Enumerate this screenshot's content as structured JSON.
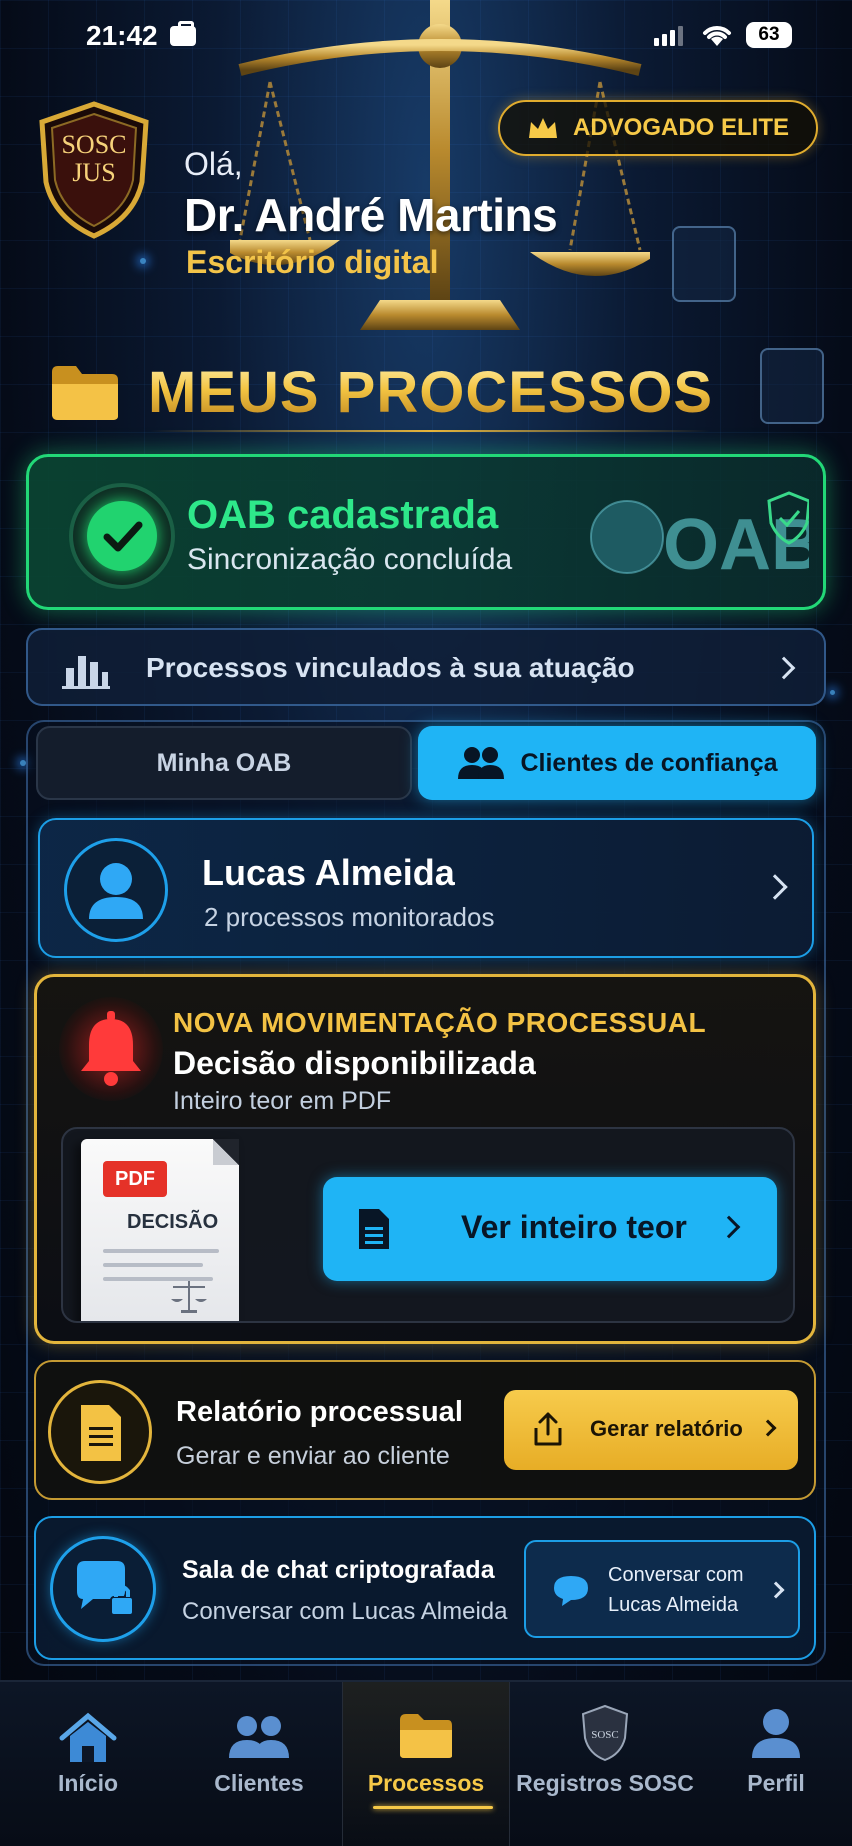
{
  "status_bar": {
    "time": "21:42",
    "battery": "63"
  },
  "header": {
    "logo_line1": "SOSC",
    "logo_line2": "JUS",
    "greeting": "Olá,",
    "user_name": "Dr. André Martins",
    "subtitle": "Escritório digital",
    "badge": "ADVOGADO ELITE"
  },
  "section": {
    "title": "MEUS PROCESSOS"
  },
  "oab_card": {
    "title": "OAB cadastrada",
    "subtitle": "Sincronização concluída",
    "logo_text": "OAB"
  },
  "linked": {
    "label": "Processos vinculados à sua atuação"
  },
  "tabs": [
    {
      "label": "Minha OAB",
      "active": false
    },
    {
      "label": "Clientes de confiança",
      "active": true
    }
  ],
  "client": {
    "name": "Lucas Almeida",
    "subtitle": "2 processos monitorados"
  },
  "alert": {
    "kicker": "NOVA MOVIMENTAÇÃO PROCESSUAL",
    "title": "Decisão disponibilizada",
    "subtitle": "Inteiro teor em PDF",
    "pdf_tag": "PDF",
    "pdf_label": "DECISÃO",
    "button": "Ver inteiro teor"
  },
  "report": {
    "title": "Relatório processual",
    "subtitle": "Gerar e enviar ao cliente",
    "button": "Gerar relatório"
  },
  "chat": {
    "title": "Sala de chat criptografada",
    "subtitle": "Conversar com Lucas Almeida",
    "button_line1": "Conversar com",
    "button_line2": "Lucas Almeida"
  },
  "bottom_nav": {
    "items": [
      {
        "label": "Início",
        "icon": "home-icon"
      },
      {
        "label": "Clientes",
        "icon": "users-icon"
      },
      {
        "label": "Processos",
        "icon": "folder-icon",
        "active": true
      },
      {
        "label": "Registros SOSC",
        "icon": "shield-icon",
        "icon_text": "SOSC"
      },
      {
        "label": "Perfil",
        "icon": "person-icon"
      }
    ]
  },
  "colors": {
    "gold": "#f3c244",
    "green": "#22d877",
    "cyan": "#1fb4f5",
    "red_alert": "#e53228"
  }
}
